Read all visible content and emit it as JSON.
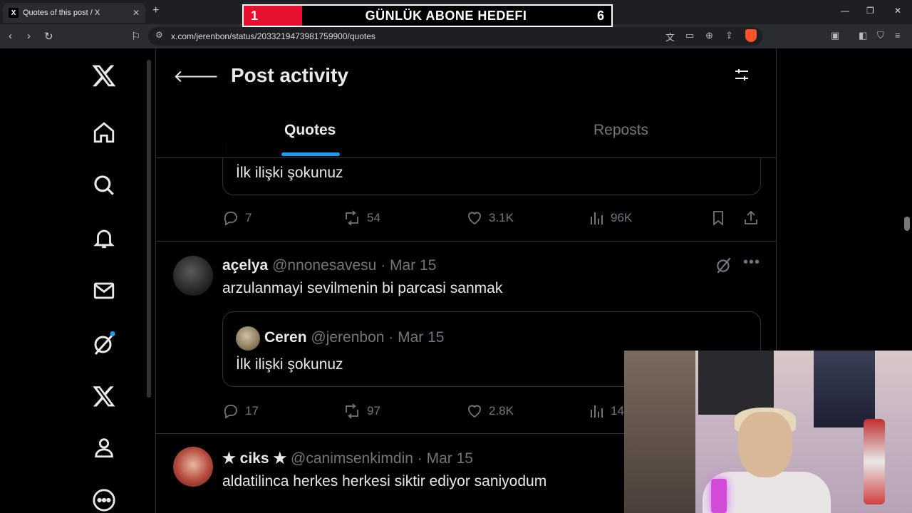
{
  "browser": {
    "tab_title": "Quotes of this post / X",
    "tab_favicon": "X",
    "url": "x.com/jerenbon/status/2033219473981759900/quotes"
  },
  "overlay": {
    "goal_current": "1",
    "goal_label": "GÜNLÜK ABONE HEDEFI",
    "goal_target": "6"
  },
  "header": {
    "title": "Post activity",
    "tabs": [
      {
        "label": "Quotes",
        "active": true
      },
      {
        "label": "Reposts",
        "active": false
      }
    ]
  },
  "tweets": [
    {
      "quote_text": "İlk ilişki şokunuz",
      "stats": {
        "replies": "7",
        "reposts": "54",
        "likes": "3.1K",
        "views": "96K"
      }
    },
    {
      "display_name": "açelya",
      "handle": "@nnonesavesu",
      "date": "· Mar 15",
      "text": "arzulanmayi sevilmenin bi parcasi sanmak",
      "quote": {
        "display_name": "Ceren",
        "handle": "@jerenbon",
        "date": "· Mar 15",
        "text": "İlk ilişki şokunuz"
      },
      "stats": {
        "replies": "17",
        "reposts": "97",
        "likes": "2.8K",
        "views": "14"
      }
    },
    {
      "display_name": "★ ciks ★",
      "handle": "@canimsenkimdin",
      "date": "· Mar 15",
      "text": "aldatilinca herkes herkesi siktir ediyor saniyodum"
    }
  ],
  "colors": {
    "accent": "#1d9bf0",
    "muted": "#71767b",
    "text": "#e7e9ea",
    "goal_red": "#e8102f"
  }
}
